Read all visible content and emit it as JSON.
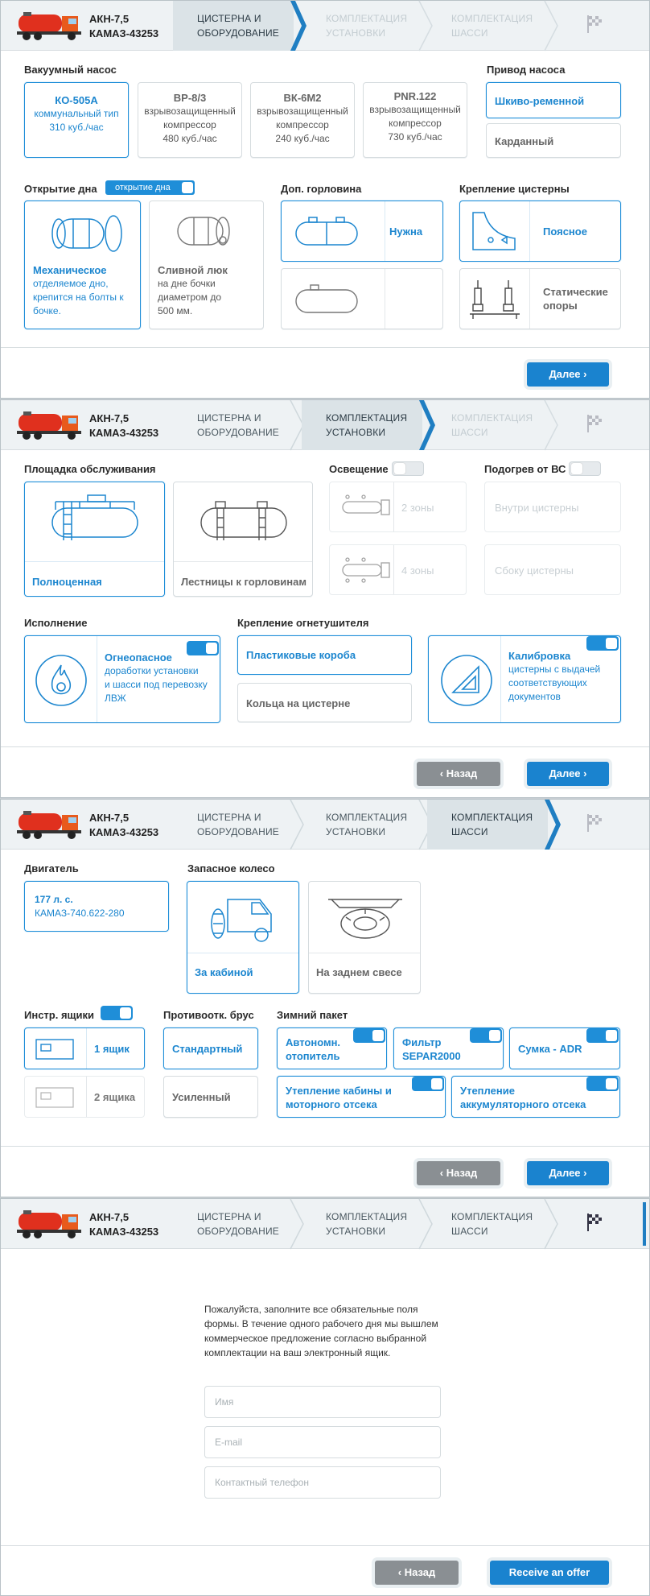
{
  "header": {
    "model_line1": "АКН-7,5",
    "model_line2": "КАМАЗ-43253",
    "steps": [
      {
        "line1": "ЦИСТЕРНА И",
        "line2": "ОБОРУДОВАНИЕ"
      },
      {
        "line1": "КОМПЛЕКТАЦИЯ",
        "line2": "УСТАНОВКИ"
      },
      {
        "line1": "КОМПЛЕКТАЦИЯ",
        "line2": "ШАССИ"
      }
    ],
    "finish_icon": "checkered-flag-icon",
    "truck_icon": "tanker-truck-icon"
  },
  "colors": {
    "accent": "#1f8ed8",
    "header_bg": "#eef2f4",
    "button_back": "#8a8f93"
  },
  "buttons": {
    "next": "Далее",
    "back": "Назад",
    "submit": "Receive an offer"
  },
  "step1": {
    "pump_heading": "Вакуумный насос",
    "pumps": [
      {
        "title": "КО-505А",
        "sub1": "коммунальный тип",
        "sub2": "310 куб./час"
      },
      {
        "title": "ВР-8/3",
        "sub1": "взрывозащищенный",
        "sub2": "компрессор",
        "sub3": "480 куб./час"
      },
      {
        "title": "ВК-6М2",
        "sub1": "взрывозащищенный",
        "sub2": "компрессор",
        "sub3": "240 куб./час"
      },
      {
        "title": "PNR.122",
        "sub1": "взрывозащищенный",
        "sub2": "компрессор",
        "sub3": "730 куб./час"
      }
    ],
    "drive_heading": "Привод насоса",
    "drives": [
      "Шкиво-ременной",
      "Карданный"
    ],
    "bottom_heading": "Открытие дна",
    "bottom_toggle": "открытие дна",
    "bottom_opts": [
      {
        "title": "Механическое",
        "l1": "отделяемое дно,",
        "l2": "крепится на болты к",
        "l3": "бочке."
      },
      {
        "title": "Сливной люк",
        "l1": "на дне бочки",
        "l2": "диаметром до",
        "l3": "500 мм."
      }
    ],
    "neck_heading": "Доп. горловина",
    "neck_opts": [
      "Нужна",
      ""
    ],
    "mount_heading": "Крепление цистерны",
    "mount_opts": [
      "Поясное",
      "Статические",
      "опоры"
    ]
  },
  "step2": {
    "platform_heading": "Площадка обслуживания",
    "platform_opts": [
      "Полноценная",
      "Лестницы к горловинам"
    ],
    "light_heading": "Освещение",
    "light_opts": [
      "2 зоны",
      "4 зоны"
    ],
    "heat_heading": "Подогрев от ВС",
    "heat_opts": [
      "Внутри цистерны",
      "Сбоку цистерны"
    ],
    "exec_heading": "Исполнение",
    "exec": {
      "title": "Огнеопасное",
      "l1": "доработки установки",
      "l2": "и шасси под перевозку",
      "l3": "ЛВЖ"
    },
    "ext_heading": "Крепление огнетушителя",
    "ext_opts": [
      "Пластиковые короба",
      "Кольца на цистерне"
    ],
    "calib": {
      "title": "Калибровка",
      "l1": "цистерны с выдачей",
      "l2": "соответствующих",
      "l3": "документов"
    }
  },
  "step3": {
    "engine_heading": "Двигатель",
    "engine_l1": "177 л. с.",
    "engine_l2": "КАМАЗ-740.622-280",
    "spare_heading": "Запасное колесо",
    "spare_opts": [
      "За кабиной",
      "На заднем свесе"
    ],
    "tools_heading": "Инстр. ящики",
    "tools_opts": [
      "1 ящик",
      "2 ящика"
    ],
    "bar_heading": "Противоотк. брус",
    "bar_opts": [
      "Стандартный",
      "Усиленный"
    ],
    "winter_heading": "Зимний пакет",
    "winter_opts": [
      {
        "l1": "Автономн.",
        "l2": "отопитель"
      },
      {
        "l1": "Фильтр",
        "l2": "SEPAR2000"
      },
      {
        "l1": "Сумка - ADR",
        "l2": ""
      },
      {
        "l1": "Утепление кабины и",
        "l2": "моторного отсека"
      },
      {
        "l1": "Утепление",
        "l2": "аккумуляторного отсека"
      }
    ]
  },
  "step4": {
    "intro": "Пожалуйста, заполните все обязательные поля формы. В течение одного рабочего дня мы вышлем коммерческое предложение согласно выбранной комплектации на ваш электронный ящик.",
    "fields": [
      "Имя",
      "E-mail",
      "Контактный телефон"
    ]
  }
}
